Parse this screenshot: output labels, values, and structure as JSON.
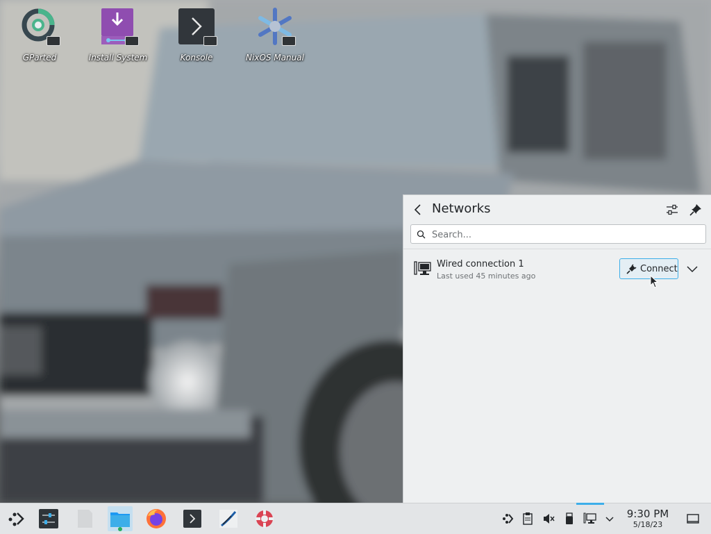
{
  "desktop": {
    "icons": [
      {
        "label": "GParted",
        "icon": "gparted-icon"
      },
      {
        "label": "Install System",
        "icon": "install-system-icon"
      },
      {
        "label": "Konsole",
        "icon": "konsole-icon"
      },
      {
        "label": "NixOS Manual",
        "icon": "nixos-manual-icon"
      }
    ]
  },
  "networks": {
    "title": "Networks",
    "search_placeholder": "Search...",
    "search_value": "",
    "connections": [
      {
        "name": "Wired connection 1",
        "subtitle": "Last used 45 minutes ago",
        "action_label": "Connect"
      }
    ]
  },
  "taskbar": {
    "apps": [
      "app-launcher",
      "system-settings",
      "blank-file",
      "dolphin-file-manager",
      "firefox",
      "konsole",
      "kde-partition-tool",
      "help-center"
    ],
    "tray": [
      "kde-connect-icon",
      "clipboard-icon",
      "volume-muted-icon",
      "usb-icon",
      "network-wired-icon",
      "expand-tray-icon"
    ],
    "clock": {
      "time": "9:30 PM",
      "date": "5/18/23"
    }
  },
  "colors": {
    "accent": "#3daee9",
    "panel_bg": "#eef0f1",
    "taskbar_bg": "#e3e5e7"
  }
}
